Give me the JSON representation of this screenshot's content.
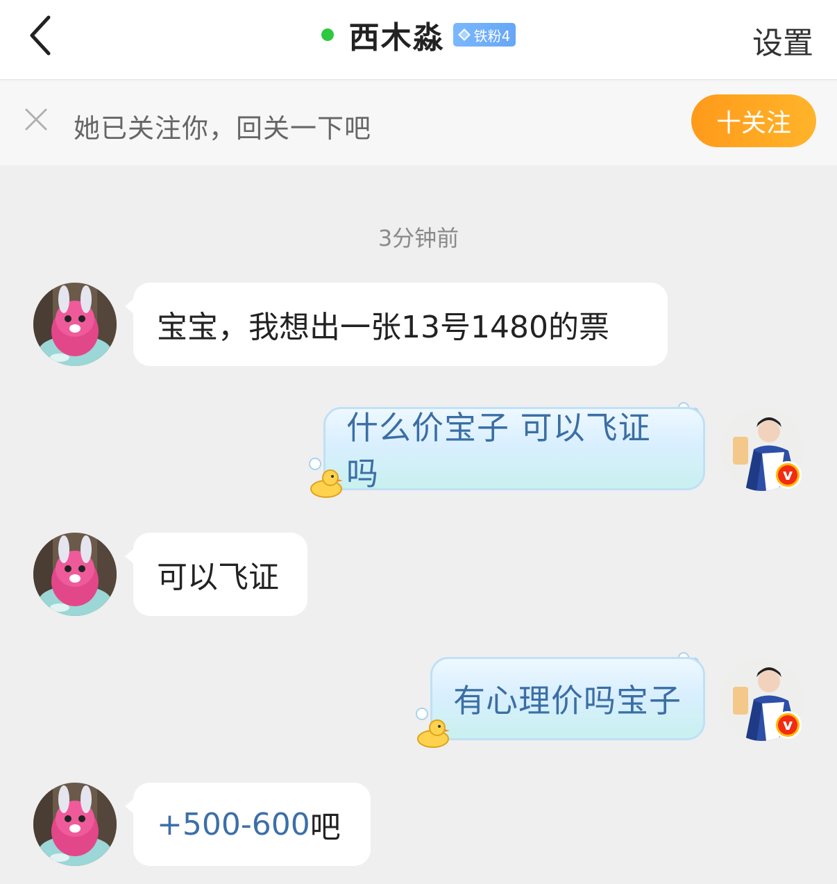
{
  "header": {
    "title": "西木淼",
    "fan_badge": "铁粉4",
    "settings_label": "设置",
    "online_color": "#2dc93f"
  },
  "follow_prompt": {
    "text": "她已关注你，回关一下吧",
    "button_label": "十关注",
    "button_color": "#ff9f1c"
  },
  "chat": {
    "timestamp": "3分钟前",
    "messages": [
      {
        "side": "in",
        "text": "宝宝，我想出一张13号1480的票"
      },
      {
        "side": "out",
        "text": "什么价宝子 可以飞证吗"
      },
      {
        "side": "in",
        "text": "可以飞证"
      },
      {
        "side": "out",
        "text": "有心理价吗宝子"
      },
      {
        "side": "in",
        "text_prefix": "+500-600",
        "text_suffix": "吧"
      }
    ]
  },
  "icons": {
    "back": "chevron-left-icon",
    "close": "close-icon",
    "badge_gem": "diamond-icon",
    "bubble_decor": "duck-icon",
    "verified": "verified-v-icon"
  }
}
